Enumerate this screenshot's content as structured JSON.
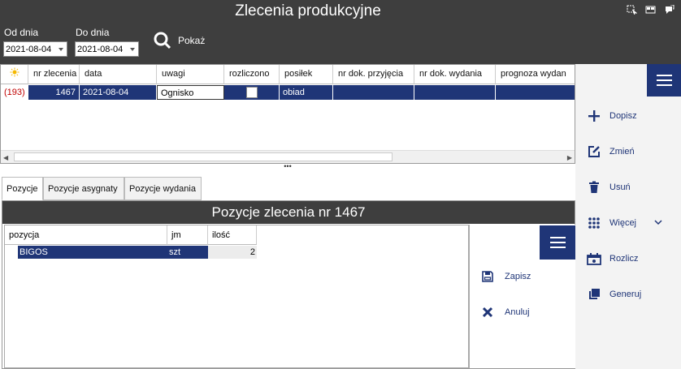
{
  "title": "Zlecenia produkcyjne",
  "filters": {
    "from_label": "Od dnia",
    "from_value": "2021-08-04",
    "to_label": "Do dnia",
    "to_value": "2021-08-04",
    "show_label": "Pokaż"
  },
  "orders_table": {
    "columns": [
      "nr zlecenia",
      "data",
      "uwagi",
      "rozliczono",
      "posiłek",
      "nr dok. przyjęcia",
      "nr dok. wydania",
      "prognoza wydan"
    ],
    "rows": [
      {
        "count": "(193)",
        "nr": "1467",
        "data": "2021-08-04",
        "uwagi": "Ognisko",
        "rozliczono": false,
        "posilek": "obiad",
        "nr_przyjecia": "",
        "nr_wydania": "",
        "prognoza": ""
      }
    ]
  },
  "splitter": "•••",
  "tabs": [
    "Pozycje",
    "Pozycje asygnaty",
    "Pozycje wydania"
  ],
  "active_tab": "Pozycje",
  "positions_title": "Pozycje zlecenia nr 1467",
  "positions_table": {
    "columns": [
      "pozycja",
      "jm",
      "ilość"
    ],
    "rows": [
      {
        "pozycja": "BIGOS",
        "jm": "szt",
        "ilosc": "2"
      }
    ]
  },
  "positions_actions": {
    "save": "Zapisz",
    "cancel": "Anuluj"
  },
  "sidebar_actions": [
    {
      "label": "Dopisz",
      "icon": "plus-icon"
    },
    {
      "label": "Zmień",
      "icon": "edit-icon"
    },
    {
      "label": "Usuń",
      "icon": "trash-icon"
    },
    {
      "label": "Więcej",
      "icon": "dots-grid-icon"
    },
    {
      "label": "Rozlicz",
      "icon": "settle-icon"
    },
    {
      "label": "Generuj",
      "icon": "copy-icon"
    }
  ],
  "colors": {
    "header_bg": "#3e3e3e",
    "accent": "#1f3577",
    "count_red": "#c00000"
  }
}
